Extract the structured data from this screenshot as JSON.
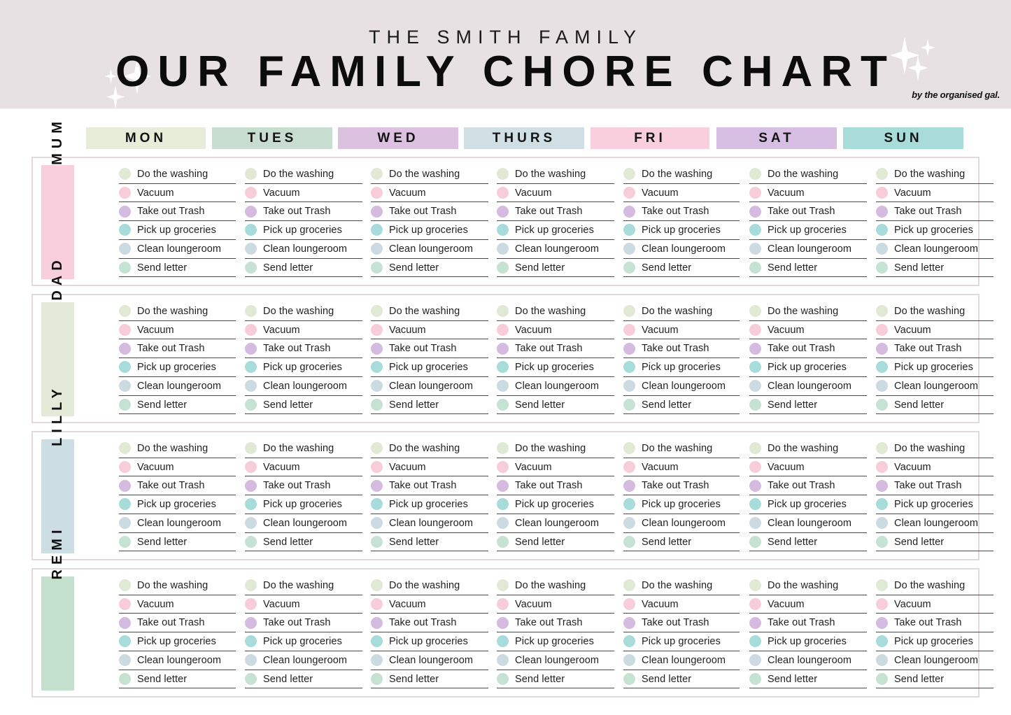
{
  "header": {
    "subtitle": "THE SMITH FAMILY",
    "title": "OUR FAMILY CHORE CHART",
    "credit": "by the organised gal.",
    "background": "#e7e1e4",
    "sparkle_icon": "sparkle-star-icon"
  },
  "days": [
    {
      "label": "MON",
      "color": "#e6eeda"
    },
    {
      "label": "TUES",
      "color": "#c6ddd0"
    },
    {
      "label": "WED",
      "color": "#dcc1e0"
    },
    {
      "label": "THURS",
      "color": "#cfdfe4"
    },
    {
      "label": "FRI",
      "color": "#f9cedd"
    },
    {
      "label": "SAT",
      "color": "#d6bfe2"
    },
    {
      "label": "SUN",
      "color": "#a8dcd9"
    }
  ],
  "chores": [
    {
      "label": "Do the washing",
      "dot": "#dfe9d4"
    },
    {
      "label": "Vacuum",
      "dot": "#f7cdd9"
    },
    {
      "label": "Take out Trash",
      "dot": "#d5bbe0"
    },
    {
      "label": "Pick up groceries",
      "dot": "#a7dcdb"
    },
    {
      "label": "Clean loungeroom",
      "dot": "#ccdae2"
    },
    {
      "label": "Send letter",
      "dot": "#c6e2d3"
    }
  ],
  "people": [
    {
      "name": "MUM",
      "color": "#f9cedd"
    },
    {
      "name": "DAD",
      "color": "#e3ebd8"
    },
    {
      "name": "LILLY",
      "color": "#ccdde4"
    },
    {
      "name": "REMI",
      "color": "#c3dfcd"
    }
  ],
  "layout": {
    "card_border_color": "#e3d9da",
    "chore_line_color": "#4a4a4a"
  }
}
